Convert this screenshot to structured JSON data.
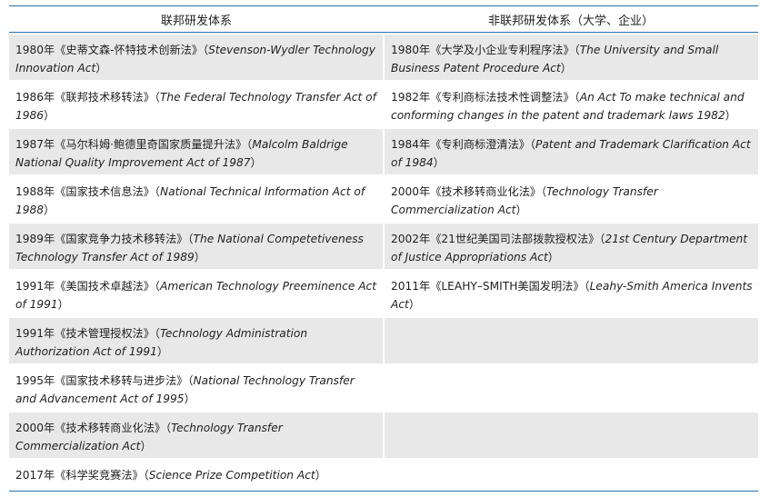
{
  "table": {
    "headers": [
      "联邦研发体系",
      "非联邦研发体系（大学、企业）"
    ],
    "rows": [
      [
        {
          "zh": "1980年《史蒂文森-怀特技术创新法》（",
          "en": "Stevenson-Wydler Technology Innovation Act",
          "end": "）"
        },
        {
          "zh": "1980年《大学及小企业专利程序法》（",
          "en": "The University and Small Business Patent Procedure Act",
          "end": "）"
        }
      ],
      [
        {
          "zh": "1986年《联邦技术移转法》（",
          "en": "The Federal Technology Transfer Act of 1986",
          "end": "）"
        },
        {
          "zh": "1982年《专利商标法技术性调整法》（",
          "en": "An Act To make technical and conforming changes in the patent and trademark laws 1982",
          "end": "）"
        }
      ],
      [
        {
          "zh": "1987年《马尔科姆·鲍德里奇国家质量提升法》（",
          "en": "Malcolm Baldrige National Quality Improvement Act of 1987",
          "end": "）"
        },
        {
          "zh": "1984年《专利商标澄清法》（",
          "en": "Patent and Trademark Clarification Act of 1984",
          "end": "）"
        }
      ],
      [
        {
          "zh": "1988年《国家技术信息法》（",
          "en": "National Technical Information Act of 1988",
          "end": "）"
        },
        {
          "zh": "2000年《技术移转商业化法》（",
          "en": "Technology Transfer Commercialization Act",
          "end": "）"
        }
      ],
      [
        {
          "zh": "1989年《国家竞争力技术移转法》（",
          "en": "The National Competetiveness Technology Transfer Act of 1989",
          "end": "）"
        },
        {
          "zh": "2002年《21世纪美国司法部拨款授权法》（",
          "en": "21st Century Department of Justice Appropriations Act",
          "end": "）"
        }
      ],
      [
        {
          "zh": "1991年《美国技术卓越法》（",
          "en": "American Technology Preeminence Act of 1991",
          "end": "）"
        },
        {
          "zh": "2011年《LEAHY–SMITH美国发明法》（",
          "en": "Leahy-Smith America Invents Act",
          "end": "）"
        }
      ],
      [
        {
          "zh": "1991年《技术管理授权法》（",
          "en": "Technology Administration Authorization Act of 1991",
          "end": "）"
        },
        {
          "zh": "",
          "en": "",
          "end": ""
        }
      ],
      [
        {
          "zh": "1995年《国家技术移转与进步法》（",
          "en": "National Technology Transfer and Advancement Act of 1995",
          "end": "）"
        },
        {
          "zh": "",
          "en": "",
          "end": ""
        }
      ],
      [
        {
          "zh": "2000年《技术移转商业化法》（",
          "en": "Technology Transfer Commercialization Act",
          "end": "）"
        },
        {
          "zh": "",
          "en": "",
          "end": ""
        }
      ],
      [
        {
          "zh": "2017年《科学奖竞赛法》（",
          "en": "Science Prize Competition Act",
          "end": "）"
        },
        {
          "zh": "",
          "en": "",
          "end": ""
        }
      ]
    ]
  },
  "colors": {
    "rule": "#2a6fb0",
    "shade": "#e8e8e8"
  }
}
